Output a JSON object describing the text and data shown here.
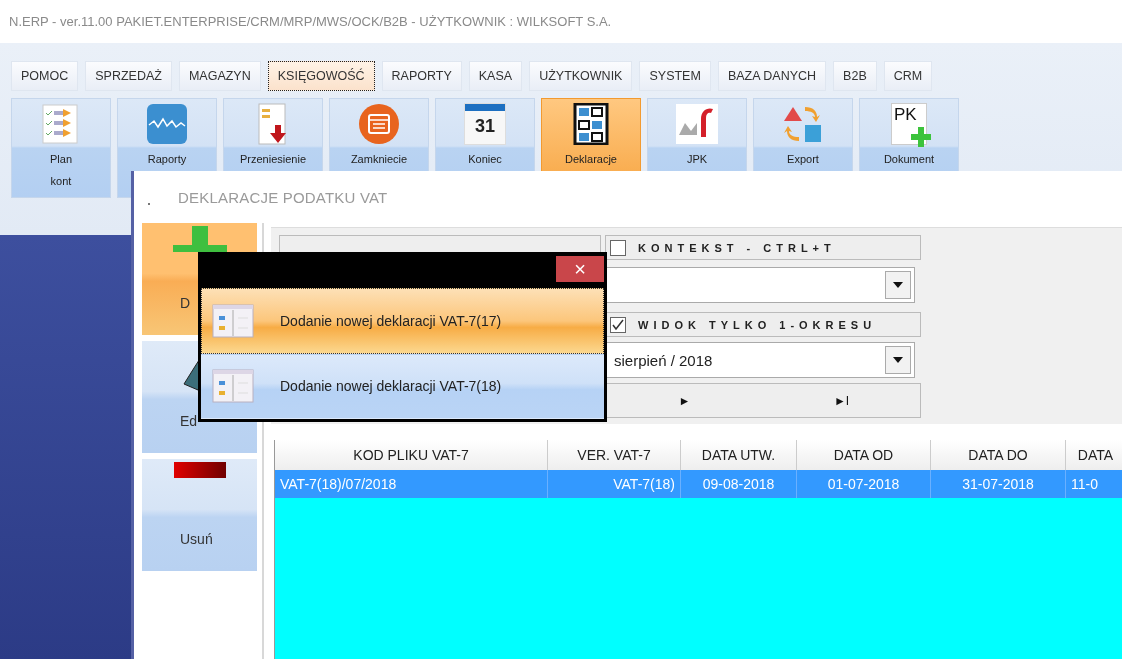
{
  "window": {
    "title": "N.ERP - ver.11.00 PAKIET.ENTERPRISE/CRM/MRP/MWS/OCK/B2B - UŻYTKOWNIK : WILKSOFT S.A."
  },
  "tabs": [
    {
      "label": "POMOC",
      "selected": false
    },
    {
      "label": "SPRZEDAŻ",
      "selected": false
    },
    {
      "label": "MAGAZYN",
      "selected": false
    },
    {
      "label": "KSIĘGOWOŚĆ",
      "selected": true
    },
    {
      "label": "RAPORTY",
      "selected": false
    },
    {
      "label": "KASA",
      "selected": false
    },
    {
      "label": "UŻYTKOWNIK",
      "selected": false
    },
    {
      "label": "SYSTEM",
      "selected": false
    },
    {
      "label": "BAZA DANYCH",
      "selected": false
    },
    {
      "label": "B2B",
      "selected": false
    },
    {
      "label": "CRM",
      "selected": false
    }
  ],
  "ribbon": [
    {
      "label": "Plan kont",
      "selected": false
    },
    {
      "label": "Raporty",
      "selected": false
    },
    {
      "label": "Przeniesienie",
      "selected": false
    },
    {
      "label": "Zamkniecie",
      "selected": false
    },
    {
      "label": "Koniec",
      "icon_text": "31",
      "selected": false
    },
    {
      "label": "Deklaracje",
      "selected": true
    },
    {
      "label": "JPK",
      "selected": false
    },
    {
      "label": "Export",
      "selected": false
    },
    {
      "label": "Dokument",
      "icon_text": "PK",
      "selected": false
    }
  ],
  "dialog": {
    "title": "DEKLARACJE PODATKU VAT",
    "side_buttons": [
      {
        "label": "D",
        "selected": true
      },
      {
        "label": "Ed",
        "selected": false
      },
      {
        "label": "Usuń",
        "selected": false
      }
    ],
    "filters": {
      "context": {
        "label": "KONTEKST - CTRL+T",
        "checked": false
      },
      "period": {
        "label": "WIDOK TYLKO 1-OKRESU",
        "checked": true
      },
      "period_select": {
        "value": "sierpień / 2018"
      },
      "nav": [
        "►",
        "►I"
      ]
    },
    "table": {
      "columns": [
        "KOD PLIKU VAT-7",
        "VER. VAT-7",
        "DATA UTW.",
        "DATA OD",
        "DATA DO",
        "DATA"
      ],
      "rows": [
        {
          "cells": [
            "VAT-7(18)/07/2018",
            "VAT-7(18)",
            "09-08-2018",
            "01-07-2018",
            "31-07-2018",
            "11-0"
          ],
          "selected": true
        }
      ]
    }
  },
  "popup": {
    "close": "×",
    "items": [
      {
        "label": "Dodanie nowej deklaracji VAT-7(17)",
        "selected": true
      },
      {
        "label": "Dodanie nowej deklaracji VAT-7(18)",
        "selected": false
      }
    ]
  }
}
